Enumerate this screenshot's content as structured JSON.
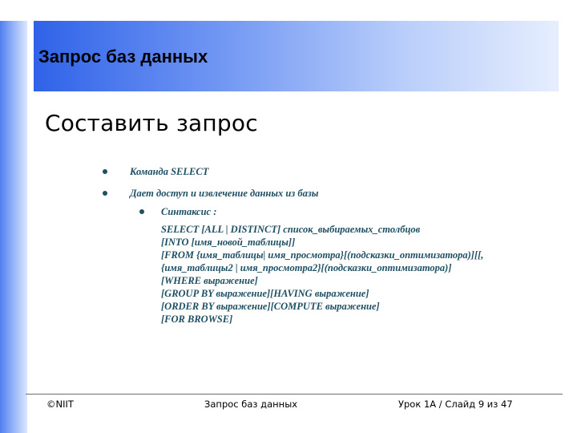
{
  "header": {
    "title": "Запрос баз данных"
  },
  "slide": {
    "heading": "Составить запрос"
  },
  "bullets": [
    {
      "text": "Команда SELECT"
    },
    {
      "text": "Дает доступ и извлечение данных из базы"
    }
  ],
  "sub_bullet": {
    "label": "Синтаксис :",
    "syntax_lines": [
      "SELECT [ALL | DISTINCT] список_выбираемых_столбцов",
      "[INTO [имя_новой_таблицы]]",
      "[FROM {имя_таблицы| имя_просмотра}[(подсказки_оптимизатора)][[,",
      "{имя_таблицы2 | имя_просмотра2}[(подсказки_оптимизатора)]",
      "[WHERE выражение]",
      "[GROUP BY выражение][HAVING выражение]",
      "[ORDER BY выражение][COMPUTE выражение]",
      "[FOR BROWSE]"
    ]
  },
  "footer": {
    "left": "©NIIT",
    "center": "Запрос баз данных",
    "right": "Урок 1A / Слайд 9 из 47"
  },
  "colors": {
    "text_accent": "#1e4f63",
    "header_gradient_start": "#2f62e8",
    "header_gradient_end": "#e6eefe"
  }
}
